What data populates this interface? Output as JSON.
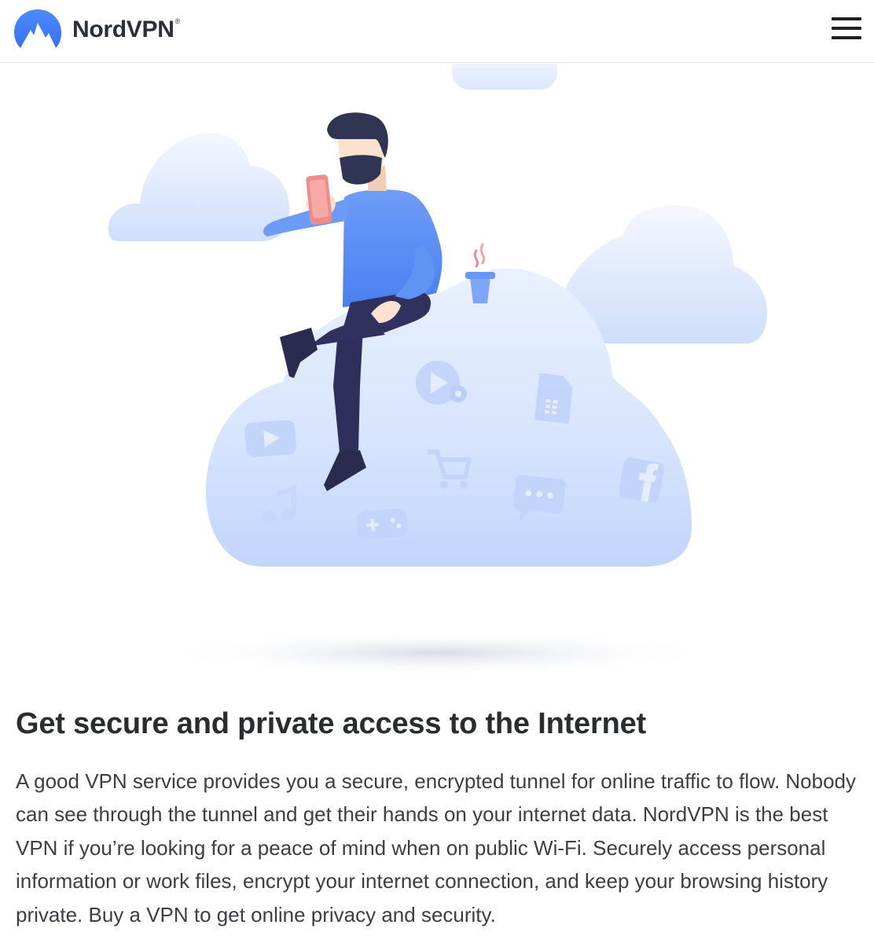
{
  "header": {
    "brand": "NordVPN",
    "trademark": "®",
    "logo_icon": "nordvpn-mountain-logo",
    "menu_icon": "hamburger-menu-icon"
  },
  "hero": {
    "illustration": "man-sitting-on-cloud-with-phone",
    "icons": [
      "video-location-icon",
      "document-icon",
      "youtube-icon",
      "shopping-cart-icon",
      "chat-icon",
      "facebook-icon",
      "music-note-icon",
      "gamepad-icon",
      "coffee-cup-icon"
    ]
  },
  "content": {
    "title": "Get secure and private access to the Internet",
    "paragraph": "A good VPN service provides you a secure, encrypted tunnel for online traffic to flow. Nobody can see through the tunnel and get their hands on your internet data. NordVPN is the best VPN if you’re looking for a peace of mind when on public Wi-Fi. Securely access personal information or work files, encrypt your internet connection, and keep your browsing history private. Buy a VPN to get online privacy and security."
  },
  "colors": {
    "brand_blue": "#4687ff",
    "text_dark": "#2b2c31",
    "cloud_light": "#e3ecfd",
    "cloud_mid": "#c6d8fb",
    "shirt_blue": "#5a90f5",
    "pants_navy": "#2e2f5b"
  }
}
